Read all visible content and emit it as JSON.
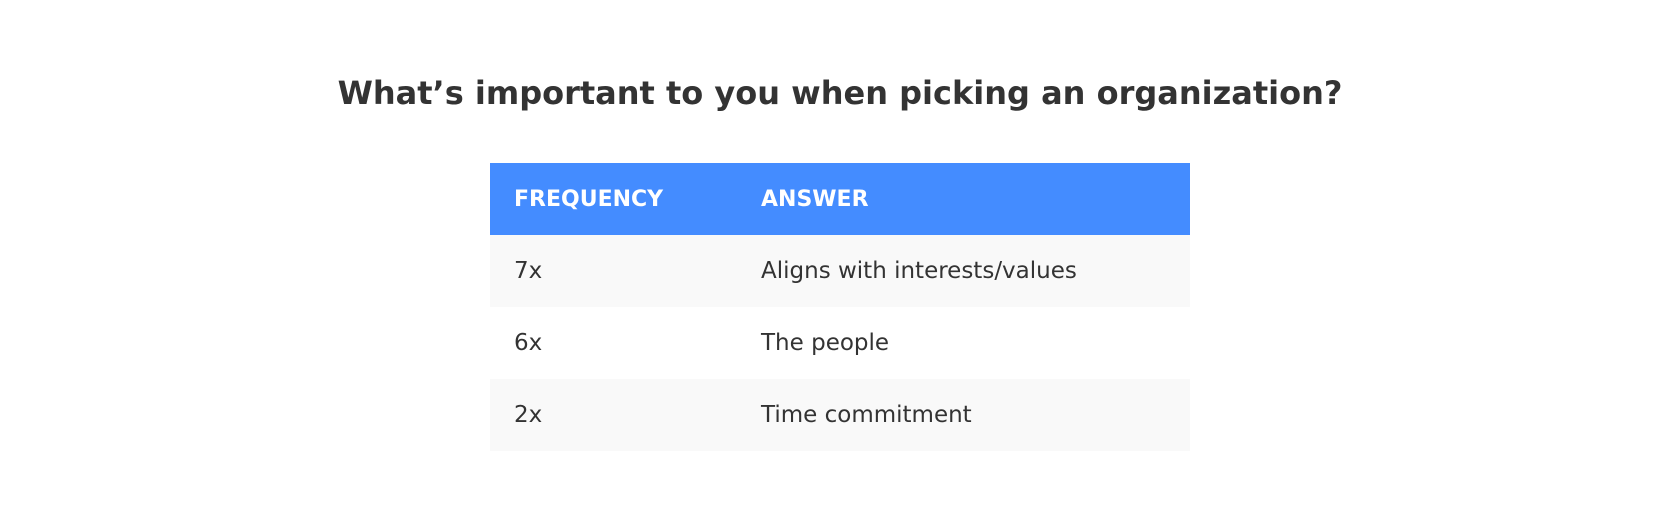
{
  "page": {
    "title": "What’s important to you when picking an organization?"
  },
  "table": {
    "header_color": "#448cff",
    "columns": [
      "FREQUENCY",
      "ANSWER"
    ],
    "rows": [
      {
        "frequency": "7x",
        "answer": "Aligns with interests/values"
      },
      {
        "frequency": "6x",
        "answer": "The people"
      },
      {
        "frequency": "2x",
        "answer": "Time commitment"
      }
    ]
  }
}
